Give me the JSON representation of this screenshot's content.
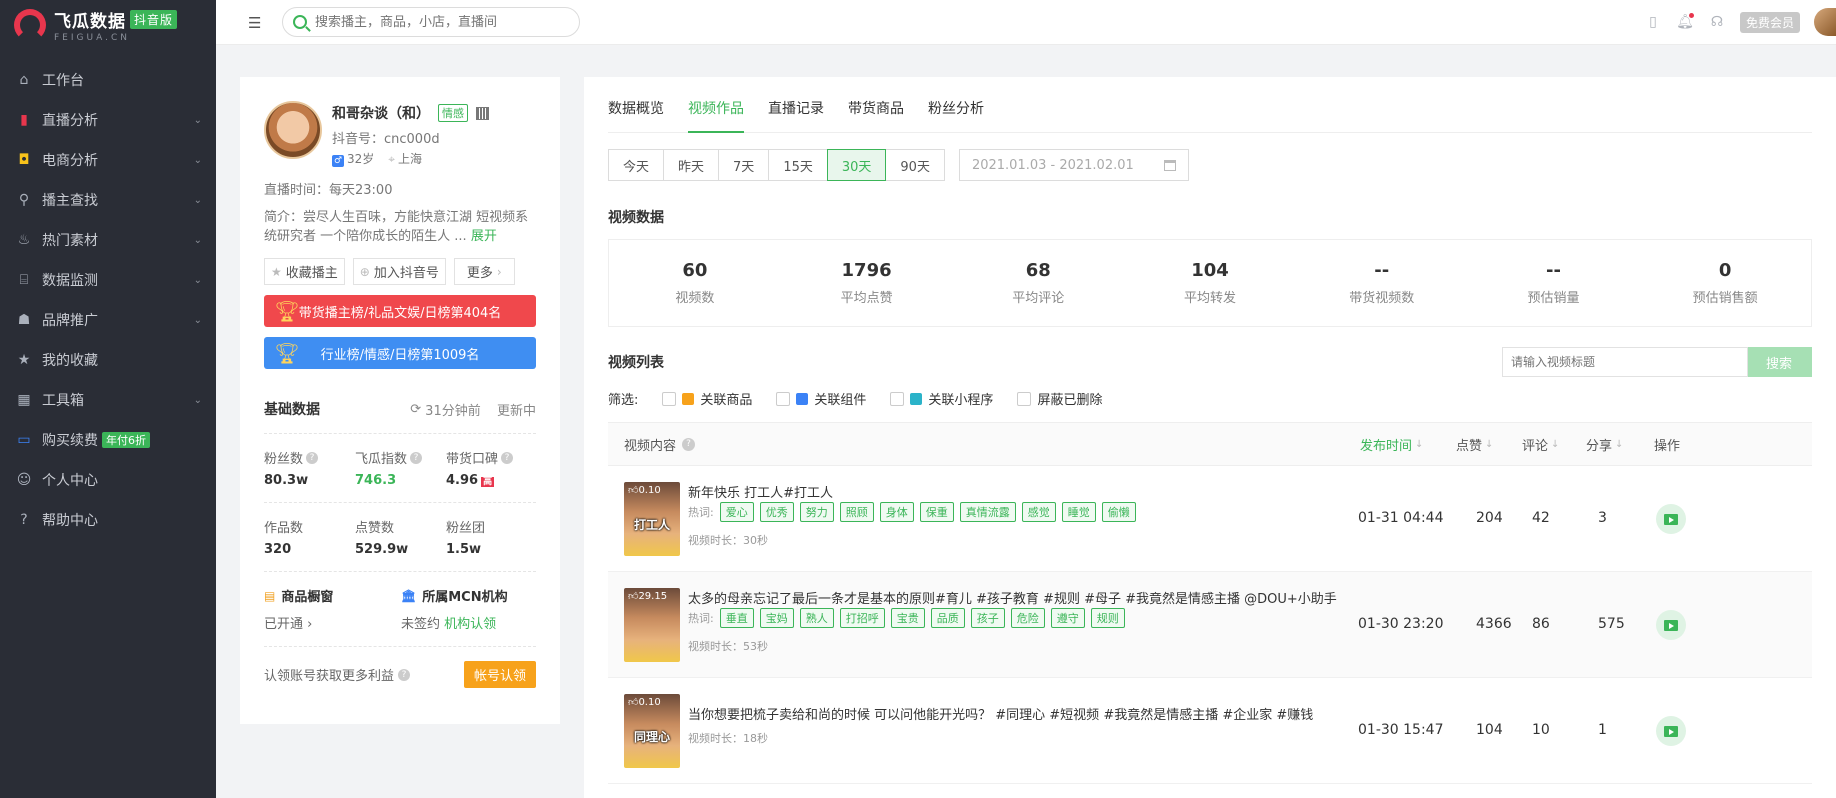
{
  "brand": {
    "name": "飞瓜数据",
    "badge": "抖音版",
    "sub": "FEIGUA.CN"
  },
  "nav": [
    {
      "label": "工作台",
      "icon": "home-icon",
      "chevron": false
    },
    {
      "label": "直播分析",
      "icon": "bar-chart-icon",
      "chevron": true
    },
    {
      "label": "电商分析",
      "icon": "shopping-bag-icon",
      "chevron": true
    },
    {
      "label": "播主查找",
      "icon": "search-icon",
      "chevron": true
    },
    {
      "label": "热门素材",
      "icon": "fire-icon",
      "chevron": true
    },
    {
      "label": "数据监测",
      "icon": "monitor-icon",
      "chevron": true
    },
    {
      "label": "品牌推广",
      "icon": "brand-icon",
      "chevron": true
    },
    {
      "label": "我的收藏",
      "icon": "star-icon",
      "chevron": false
    },
    {
      "label": "工具箱",
      "icon": "toolbox-icon",
      "chevron": true
    },
    {
      "label": "购买续费",
      "icon": "card-icon",
      "chevron": false,
      "badge": "年付6折"
    },
    {
      "label": "个人中心",
      "icon": "user-icon",
      "chevron": false
    },
    {
      "label": "帮助中心",
      "icon": "help-icon",
      "chevron": false
    }
  ],
  "topbar": {
    "search_placeholder": "搜索播主，商品，小店，直播间",
    "member": "免费会员"
  },
  "profile": {
    "name": "和哥杂谈（和）",
    "tag": "情感",
    "douyin_id": "抖音号：cnc000d",
    "age": "32岁",
    "location": "上海",
    "live_time": "直播时间：每天23:00",
    "desc": "简介：尝尽人生百味，方能快意江湖 短视频系统研究者 一个陪你成长的陌生人 ...",
    "desc_more": "展开",
    "btn_fav": "收藏播主",
    "btn_add": "加入抖音号",
    "btn_more": "更多",
    "rank1": "带货播主榜/礼品文娱/日榜第404名",
    "rank2": "行业榜/情感/日榜第1009名",
    "basic_title": "基础数据",
    "updated_ago": "31分钟前",
    "updating": "更新中",
    "stats": [
      {
        "label": "粉丝数",
        "value": "80.3w",
        "q": true
      },
      {
        "label": "飞瓜指数",
        "value": "746.3",
        "q": true,
        "green": true
      },
      {
        "label": "带货口碑",
        "value": "4.96",
        "q": true,
        "badge": "高"
      },
      {
        "label": "作品数",
        "value": "320"
      },
      {
        "label": "点赞数",
        "value": "529.9w"
      },
      {
        "label": "粉丝团",
        "value": "1.5w"
      }
    ],
    "shop_title": "商品橱窗",
    "shop_value": "已开通",
    "mcn_title": "所属MCN机构",
    "mcn_value": "未签约",
    "mcn_link": "机构认领",
    "claim_text": "认领账号获取更多利益",
    "claim_btn": "帐号认领"
  },
  "main": {
    "tabs": [
      "数据概览",
      "视频作品",
      "直播记录",
      "带货商品",
      "粉丝分析"
    ],
    "active_tab": 1,
    "date_buttons": [
      "今天",
      "昨天",
      "7天",
      "15天",
      "30天",
      "90天"
    ],
    "active_date": 4,
    "date_range": "2021.01.03 - 2021.02.01",
    "video_data_title": "视频数据",
    "metrics": [
      {
        "value": "60",
        "label": "视频数"
      },
      {
        "value": "1796",
        "label": "平均点赞"
      },
      {
        "value": "68",
        "label": "平均评论"
      },
      {
        "value": "104",
        "label": "平均转发"
      },
      {
        "value": "--",
        "label": "带货视频数"
      },
      {
        "value": "--",
        "label": "预估销量"
      },
      {
        "value": "0",
        "label": "预估销售额"
      }
    ],
    "list_title": "视频列表",
    "list_search_placeholder": "请输入视频标题",
    "list_search_btn": "搜索",
    "filter_label": "筛选:",
    "filters": [
      "关联商品",
      "关联组件",
      "关联小程序",
      "屏蔽已删除"
    ],
    "columns": {
      "content": "视频内容",
      "publish": "发布时间",
      "likes": "点赞",
      "comments": "评论",
      "shares": "分享",
      "action": "操作"
    },
    "hot_label": "热词:",
    "duration_prefix": "视频时长：",
    "rows": [
      {
        "thumb_likes": "0.10",
        "thumb_caption": "打工人",
        "title": "新年快乐 打工人#打工人",
        "tags": [
          "爱心",
          "优秀",
          "努力",
          "照顾",
          "身体",
          "保重",
          "真情流露",
          "感觉",
          "睡觉",
          "偷懒"
        ],
        "duration": "视频时长：30秒",
        "time": "01-31 04:44",
        "likes": "204",
        "comments": "42",
        "shares": "3"
      },
      {
        "thumb_likes": "29.15",
        "thumb_caption": "",
        "title": "太多的母亲忘记了最后一条才是基本的原则#育儿 #孩子教育 #规则 #母子 #我竟然是情感主播 @DOU+小助手",
        "tags": [
          "垂直",
          "宝妈",
          "熟人",
          "打招呼",
          "宝贵",
          "品质",
          "孩子",
          "危险",
          "遵守",
          "规则"
        ],
        "duration": "视频时长：53秒",
        "time": "01-30 23:20",
        "likes": "4366",
        "comments": "86",
        "shares": "575"
      },
      {
        "thumb_likes": "0.10",
        "thumb_caption": "同理心",
        "title": "当你想要把梳子卖给和尚的时候 可以问他能开光吗？ #同理心 #短视频 #我竟然是情感主播 #企业家 #赚钱",
        "tags": [],
        "duration": "视频时长：18秒",
        "time": "01-30 15:47",
        "likes": "104",
        "comments": "10",
        "shares": "1"
      }
    ]
  }
}
